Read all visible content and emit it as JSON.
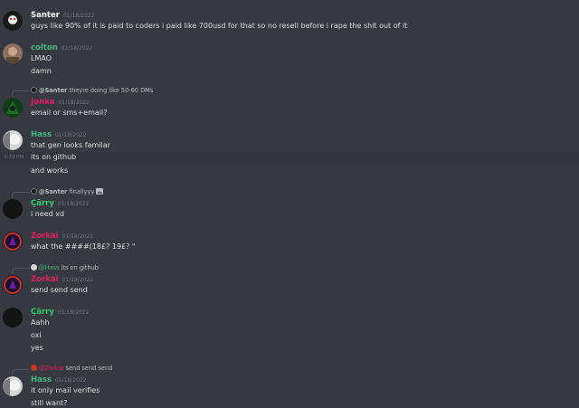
{
  "colors": {
    "background": "#36393f",
    "hover_row": "#32353b",
    "text": "#dcddde",
    "muted": "#72767d",
    "name_white": "#ffffff",
    "name_green": "#43b581",
    "name_pink": "#e91e63",
    "name_green_bright": "#2ecc71",
    "name_red": "#e74c3c"
  },
  "messages": [
    {
      "user": "Santer",
      "date": "01/18/2022",
      "lines": [
        "guys like 90% of it is paid to coders i paid like 700usd for that so no resell before i rape the shit out of it"
      ]
    },
    {
      "user": "colton",
      "date": "01/18/2022",
      "lines": [
        "LMAO",
        "damn"
      ]
    },
    {
      "reply_to": "@Santer",
      "reply_text": "theyre doing like 50-60 DMs",
      "user": "Jonko",
      "date": "01/18/2022",
      "lines": [
        "email or sms+email?"
      ]
    },
    {
      "user": "Hass",
      "date": "01/18/2022",
      "lines": [
        "that gen looks familar",
        "its on github",
        "and works"
      ],
      "hover_time": "3:29 PM"
    },
    {
      "reply_to": "@Santer",
      "reply_text": "finallyyy",
      "user": "Ҫārry",
      "date": "01/18/2022",
      "lines": [
        "i need xd"
      ]
    },
    {
      "user": "Zorkai",
      "date": "01/18/2022",
      "lines": [
        "what the ####(18£? 19£? \""
      ]
    },
    {
      "reply_to": "@Hass",
      "reply_text": "its on github",
      "user": "Zorkai",
      "date": "01/18/2022",
      "lines": [
        "send send send"
      ]
    },
    {
      "user": "Ҫārry",
      "date": "01/18/2022",
      "lines": [
        "Aahh",
        "oxi",
        "yes"
      ]
    },
    {
      "reply_to": "@Zorkai",
      "reply_text": "send send send",
      "user": "Hass",
      "date": "01/18/2022",
      "lines": [
        "it only mail verifies",
        "still want?"
      ]
    }
  ]
}
